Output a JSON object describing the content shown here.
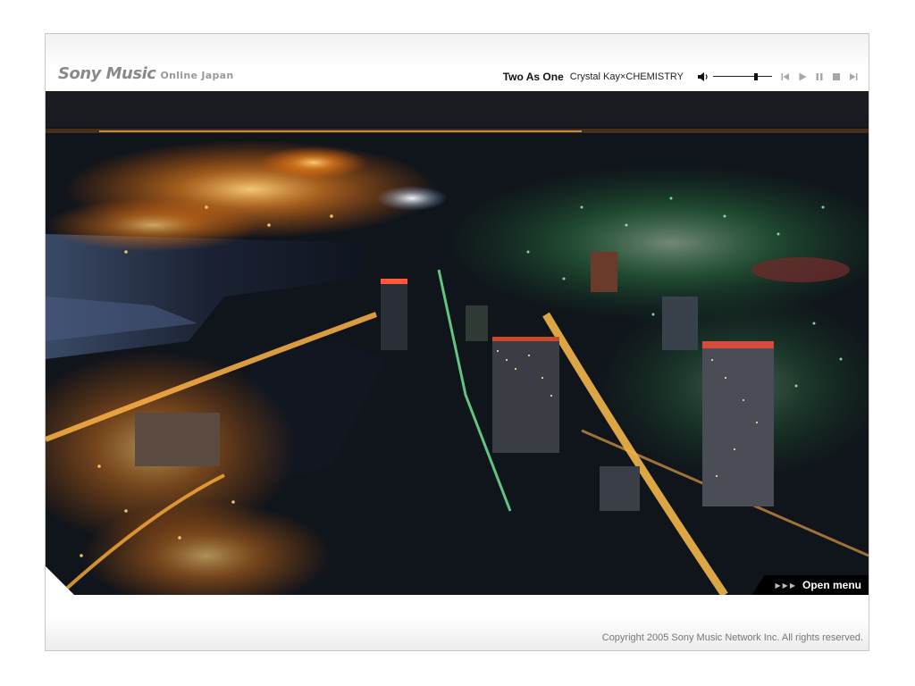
{
  "header": {
    "logo": {
      "brand": "Sony Music",
      "subtitle": "Online Japan"
    },
    "player": {
      "song_title": "Two As One",
      "artist": "Crystal Kay×CHEMISTRY",
      "volume": 0.72,
      "controls": [
        "speaker-icon",
        "previous-icon",
        "play-icon",
        "pause-icon",
        "stop-icon",
        "next-icon"
      ]
    }
  },
  "main": {
    "photo_subject": "night city skyline",
    "open_menu": {
      "label": "Open menu"
    }
  },
  "footer": {
    "copyright": "Copyright 2005 Sony Music Network Inc. All rights reserved."
  },
  "colors": {
    "brand_gray": "#8a8a8a",
    "title_text": "#111111",
    "menu_background": "#000000",
    "copyright_text": "#777777"
  }
}
